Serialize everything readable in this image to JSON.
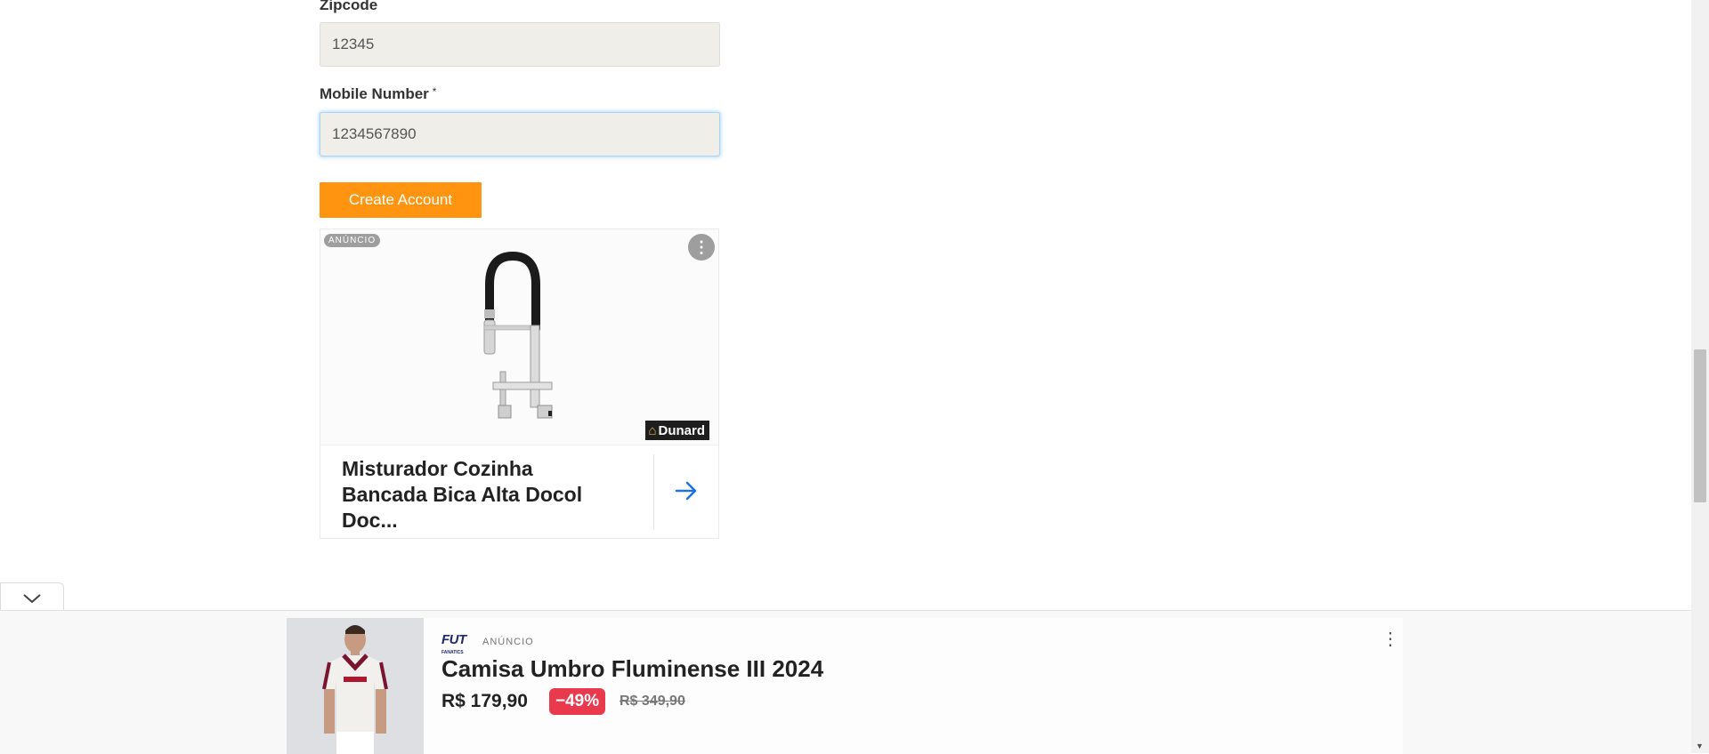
{
  "form": {
    "zipcode_label": "Zipcode",
    "zipcode_value": "12345",
    "mobile_label": "Mobile Number",
    "mobile_required": "*",
    "mobile_value": "1234567890",
    "create_button": "Create Account"
  },
  "ad": {
    "badge": "ANÚNCIO",
    "brand": "Dunard",
    "title": "Misturador Cozinha Bancada Bica Alta Docol Doc...",
    "menu_icon": "kebab-menu-icon",
    "arrow_icon": "arrow-right-icon",
    "arrow_color": "#1a73e8"
  },
  "sticky_ad": {
    "brand": "FUT",
    "brand_sub": "FANATICS",
    "label": "ANÚNCIO",
    "title": "Camisa Umbro Fluminense III 2024",
    "price": "R$ 179,90",
    "discount": "−49%",
    "old_price": "R$ 349,90",
    "discount_color": "#e8394d",
    "collapse_icon": "chevron-down-icon"
  },
  "colors": {
    "accent": "#ff9410",
    "input_bg": "#efeee9",
    "focus_ring": "#a9d4f2"
  }
}
